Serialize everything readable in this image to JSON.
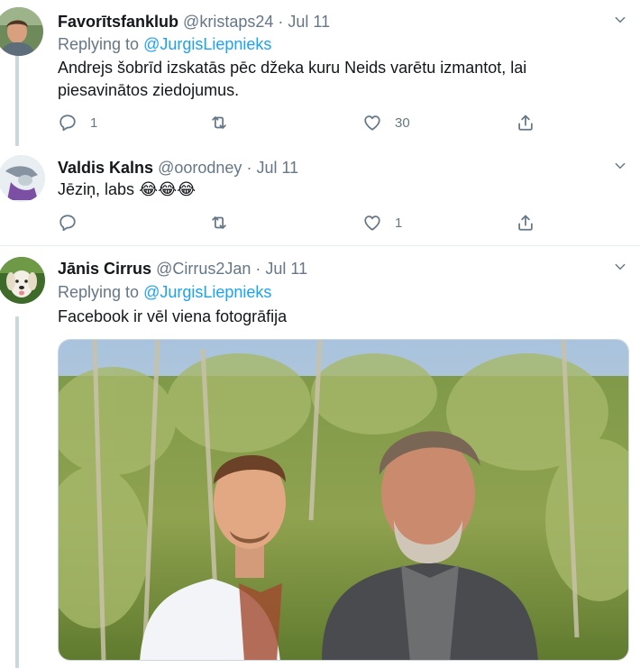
{
  "tweets": [
    {
      "display_name": "Favorītsfanklub",
      "handle": "@kristaps24",
      "separator": "·",
      "date": "Jul 11",
      "replying_prefix": "Replying to",
      "replying_mention": "@JurgisLiepnieks",
      "text": "Andrejs šobrīd izskatās pēc džeka kuru Neids varētu izmantot, lai piesavinātos ziedojumus.",
      "reply_count": "1",
      "retweet_count": "",
      "like_count": "30"
    },
    {
      "display_name": "Valdis Kalns",
      "handle": "@oorodney",
      "separator": "·",
      "date": "Jul 11",
      "text": "Jēziņ, labs",
      "emojis": "😂😂😂",
      "reply_count": "",
      "retweet_count": "",
      "like_count": "1"
    },
    {
      "display_name": "Jānis Cirrus",
      "handle": "@Cirrus2Jan",
      "separator": "·",
      "date": "Jul 11",
      "replying_prefix": "Replying to",
      "replying_mention": "@JurgisLiepnieks",
      "text": "Facebook ir vēl viena fotogrāfija"
    }
  ],
  "icons": {
    "reply": "reply-icon",
    "retweet": "retweet-icon",
    "like": "heart-icon",
    "share": "share-icon",
    "more": "chevron-down-icon"
  },
  "colors": {
    "link": "#1da1f2",
    "secondary_text": "#657786",
    "thread_line": "#ccd6dd",
    "divider": "#e6ecf0"
  }
}
